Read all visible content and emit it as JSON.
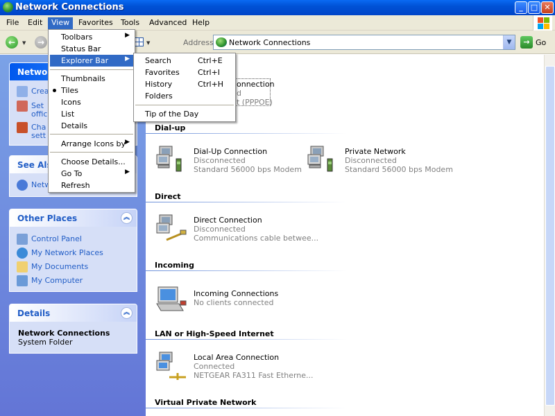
{
  "window": {
    "title": "Network Connections",
    "controls": {
      "minimize": "_",
      "maximize": "□",
      "close": "✕"
    }
  },
  "menubar": [
    "File",
    "Edit",
    "View",
    "Favorites",
    "Tools",
    "Advanced",
    "Help"
  ],
  "toolbar": {
    "address_label": "Address",
    "address_value": "Network Connections",
    "go_label": "Go"
  },
  "view_menu": {
    "items": [
      "Toolbars",
      "Status Bar",
      "Explorer Bar",
      "Thumbnails",
      "Tiles",
      "Icons",
      "List",
      "Details",
      "Arrange Icons by",
      "Choose Details...",
      "Go To",
      "Refresh"
    ],
    "checked": "Tiles",
    "highlighted": "Explorer Bar"
  },
  "explorer_bar_menu": {
    "items": [
      {
        "label": "Search",
        "accel": "Ctrl+E"
      },
      {
        "label": "Favorites",
        "accel": "Ctrl+I"
      },
      {
        "label": "History",
        "accel": "Ctrl+H"
      },
      {
        "label": "Folders",
        "accel": ""
      },
      {
        "label": "Tip of the Day",
        "accel": ""
      }
    ]
  },
  "left_pane": {
    "network_tasks": {
      "title": "Network",
      "items": [
        "Crea",
        "Set",
        "offic",
        "Cha",
        "sett"
      ]
    },
    "see_also": {
      "title": "See Also",
      "items": [
        "Netw"
      ]
    },
    "other_places": {
      "title": "Other Places",
      "items": [
        "Control Panel",
        "My Network Places",
        "My Documents",
        "My Computer"
      ]
    },
    "details": {
      "title": "Details",
      "name": "Network Connections",
      "type": "System Folder"
    }
  },
  "content": {
    "partial_tile": {
      "name": "onnection",
      "status": "d",
      "device": "t (PPPOE)"
    },
    "groups": [
      {
        "title": "Dial-up",
        "tiles": [
          {
            "name": "Dial-Up Connection",
            "status": "Disconnected",
            "device": "Standard 56000 bps Modem"
          },
          {
            "name": "Private Network",
            "status": "Disconnected",
            "device": "Standard 56000 bps Modem"
          }
        ]
      },
      {
        "title": "Direct",
        "tiles": [
          {
            "name": "Direct Connection",
            "status": "Disconnected",
            "device": "Communications cable betwee..."
          }
        ]
      },
      {
        "title": "Incoming",
        "tiles": [
          {
            "name": "Incoming Connections",
            "status": "No clients connected",
            "device": ""
          }
        ]
      },
      {
        "title": "LAN or High-Speed Internet",
        "tiles": [
          {
            "name": "Local Area Connection",
            "status": "Connected",
            "device": "NETGEAR FA311 Fast Etherne..."
          }
        ]
      },
      {
        "title": "Virtual Private Network",
        "tiles": []
      }
    ]
  },
  "colors": {
    "titlebar": "#0054e3",
    "menu_highlight": "#316ac5",
    "taskpane": "#6f8fe0",
    "link": "#215dc6"
  }
}
